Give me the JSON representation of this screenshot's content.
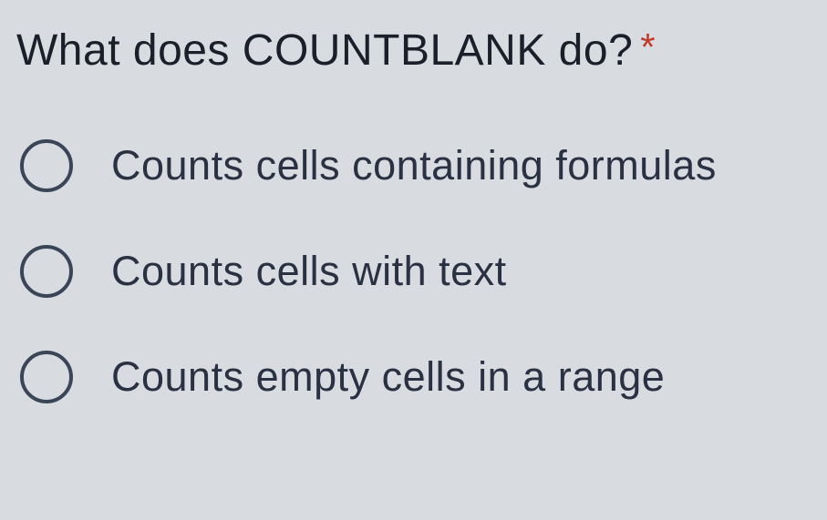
{
  "question": {
    "text": "What does COUNTBLANK do?",
    "required_marker": "*"
  },
  "options": [
    {
      "label": "Counts cells containing formulas"
    },
    {
      "label": "Counts cells with text"
    },
    {
      "label": "Counts empty cells in a range"
    }
  ]
}
